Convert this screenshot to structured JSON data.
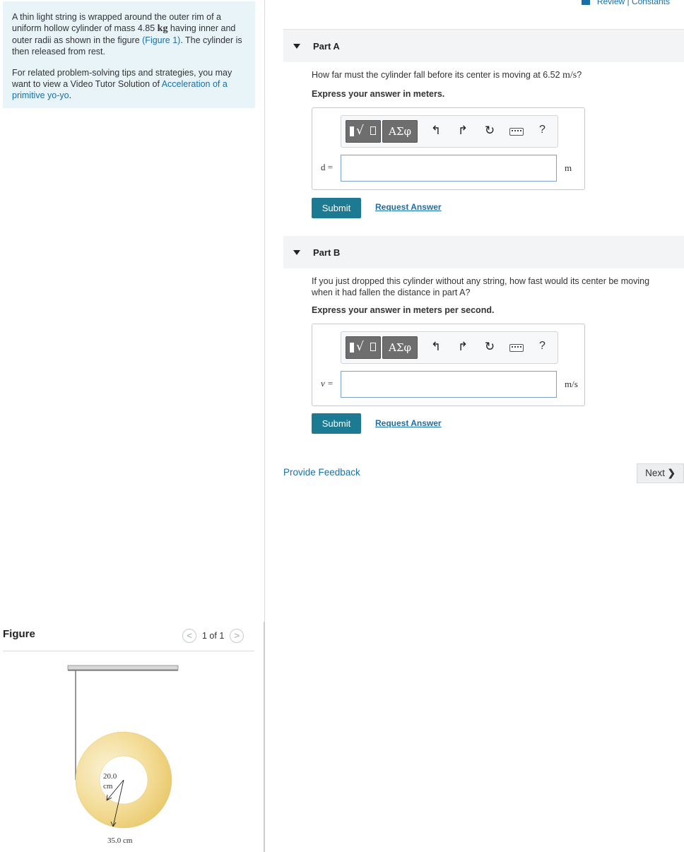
{
  "header": {
    "review_constants": "Review | Constants"
  },
  "intro": {
    "text_1": "A thin light string is wrapped around the outer rim of a uniform hollow cylinder of mass 4.85 ",
    "mass_unit": "kg",
    "text_2": " having inner and outer radii as shown in the figure ",
    "figure_link": "(Figure 1)",
    "text_3": ". The cylinder is then released from rest.",
    "tips_1": "For related problem-solving tips and strategies, you may want to view a Video Tutor Solution of ",
    "tips_link": "Acceleration of a primitive yo-yo",
    "tips_end": "."
  },
  "part_a": {
    "title": "Part A",
    "question_1": "How far must the cylinder fall before its center is moving at 6.52 ",
    "question_unit": "m/s",
    "question_end": "?",
    "instruction": "Express your answer in meters.",
    "variable": "d =",
    "unit": "m",
    "input_value": "",
    "submit": "Submit",
    "request": "Request Answer"
  },
  "part_b": {
    "title": "Part B",
    "question": "If you just dropped this cylinder without any string, how fast would its center be moving when it had fallen the distance in part A?",
    "instruction": "Express your answer in meters per second.",
    "variable": "v =",
    "unit": "m/s",
    "input_value": "",
    "submit": "Submit",
    "request": "Request Answer"
  },
  "toolbar": {
    "greek": "ΑΣφ",
    "help": "?",
    "icons": [
      "templates-icon",
      "greek-letters-icon",
      "undo-icon",
      "redo-icon",
      "reset-icon",
      "keyboard-icon",
      "help-icon"
    ]
  },
  "footer": {
    "feedback": "Provide Feedback",
    "next": "Next"
  },
  "figure": {
    "title": "Figure",
    "pager": "1 of 1",
    "inner_label_1": "20.0",
    "inner_label_2": "cm",
    "outer_label": "35.0 cm"
  },
  "colors": {
    "accent": "#1c7a93",
    "link": "#1a6fa8",
    "intro_bg": "#e8f4f7",
    "cylinder": "#f0d78a"
  }
}
